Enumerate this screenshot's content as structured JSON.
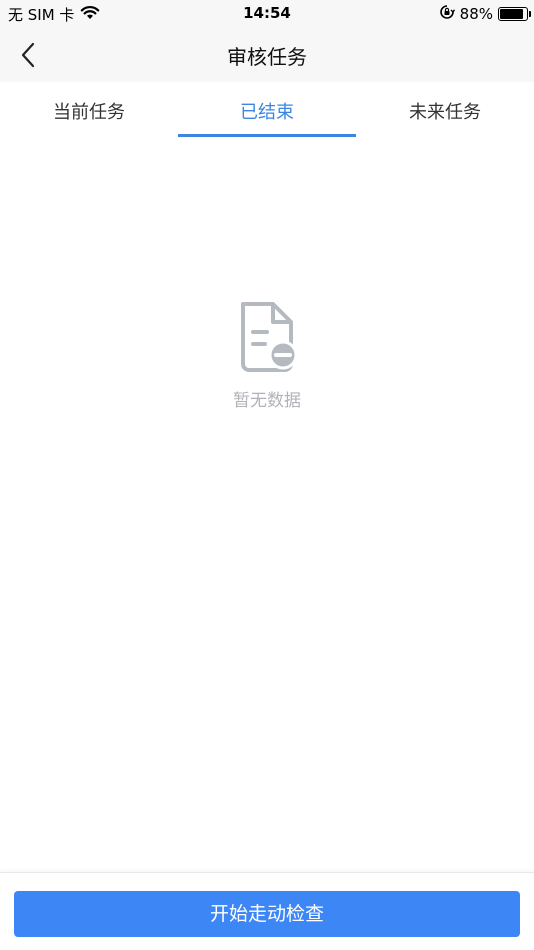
{
  "status_bar": {
    "carrier": "无 SIM 卡",
    "time": "14:54",
    "battery_percent": "88%",
    "battery_level": 0.88,
    "icons": [
      "wifi-icon",
      "orientation-lock-icon",
      "battery-icon"
    ]
  },
  "nav": {
    "title": "审核任务",
    "back_icon": "chevron-left-icon"
  },
  "tabs": [
    {
      "label": "当前任务",
      "active": false
    },
    {
      "label": "已结束",
      "active": true
    },
    {
      "label": "未来任务",
      "active": false
    }
  ],
  "empty_state": {
    "icon": "document-remove-icon",
    "text": "暂无数据"
  },
  "footer": {
    "primary_button": "开始走动检查"
  },
  "colors": {
    "accent": "#3a86e0",
    "button": "#3d86f5",
    "muted": "#b0b3b8"
  }
}
